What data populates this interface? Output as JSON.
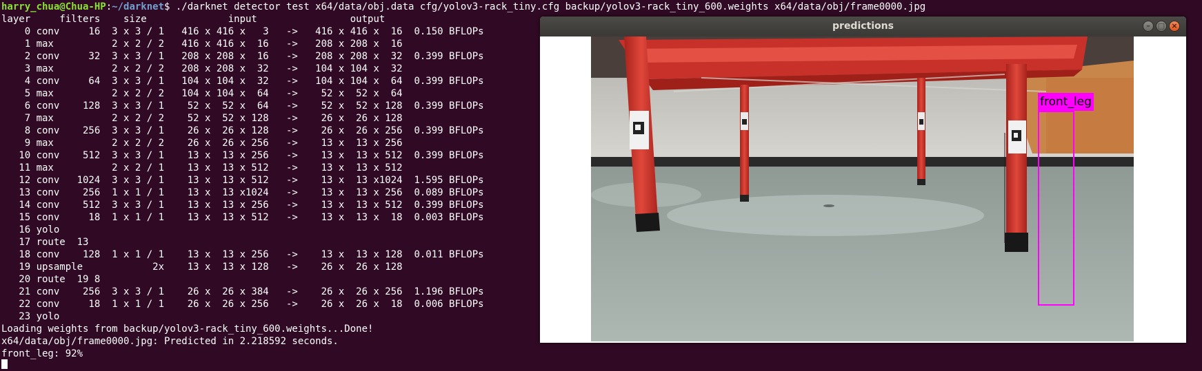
{
  "terminal": {
    "prompt": {
      "user_host": "harry_chua@Chua-HP",
      "separator": ":",
      "path": "~/darknet",
      "symbol": "$",
      "command": " ./darknet detector test x64/data/obj.data cfg/yolov3-rack_tiny.cfg backup/yolov3-rack_tiny_600.weights x64/data/obj/frame0000.jpg"
    },
    "header": "layer     filters    size              input                output",
    "layers": [
      "    0 conv     16  3 x 3 / 1   416 x 416 x   3   ->   416 x 416 x  16  0.150 BFLOPs",
      "    1 max          2 x 2 / 2   416 x 416 x  16   ->   208 x 208 x  16",
      "    2 conv     32  3 x 3 / 1   208 x 208 x  16   ->   208 x 208 x  32  0.399 BFLOPs",
      "    3 max          2 x 2 / 2   208 x 208 x  32   ->   104 x 104 x  32",
      "    4 conv     64  3 x 3 / 1   104 x 104 x  32   ->   104 x 104 x  64  0.399 BFLOPs",
      "    5 max          2 x 2 / 2   104 x 104 x  64   ->    52 x  52 x  64",
      "    6 conv    128  3 x 3 / 1    52 x  52 x  64   ->    52 x  52 x 128  0.399 BFLOPs",
      "    7 max          2 x 2 / 2    52 x  52 x 128   ->    26 x  26 x 128",
      "    8 conv    256  3 x 3 / 1    26 x  26 x 128   ->    26 x  26 x 256  0.399 BFLOPs",
      "    9 max          2 x 2 / 2    26 x  26 x 256   ->    13 x  13 x 256",
      "   10 conv    512  3 x 3 / 1    13 x  13 x 256   ->    13 x  13 x 512  0.399 BFLOPs",
      "   11 max          2 x 2 / 1    13 x  13 x 512   ->    13 x  13 x 512",
      "   12 conv   1024  3 x 3 / 1    13 x  13 x 512   ->    13 x  13 x1024  1.595 BFLOPs",
      "   13 conv    256  1 x 1 / 1    13 x  13 x1024   ->    13 x  13 x 256  0.089 BFLOPs",
      "   14 conv    512  3 x 3 / 1    13 x  13 x 256   ->    13 x  13 x 512  0.399 BFLOPs",
      "   15 conv     18  1 x 1 / 1    13 x  13 x 512   ->    13 x  13 x  18  0.003 BFLOPs",
      "   16 yolo",
      "   17 route  13",
      "   18 conv    128  1 x 1 / 1    13 x  13 x 256   ->    13 x  13 x 128  0.011 BFLOPs",
      "   19 upsample            2x    13 x  13 x 128   ->    26 x  26 x 128",
      "   20 route  19 8",
      "   21 conv    256  3 x 3 / 1    26 x  26 x 384   ->    26 x  26 x 256  1.196 BFLOPs",
      "   22 conv     18  1 x 1 / 1    26 x  26 x 256   ->    26 x  26 x  18  0.006 BFLOPs",
      "   23 yolo"
    ],
    "footer": [
      "Loading weights from backup/yolov3-rack_tiny_600.weights...Done!",
      "x64/data/obj/frame0000.jpg: Predicted in 2.218592 seconds.",
      "front_leg: 92%"
    ]
  },
  "window": {
    "title": "predictions",
    "buttons": {
      "minimize": "–",
      "maximize": "□",
      "close": "×"
    },
    "detection": {
      "label": "front_leg",
      "box_color": "#ff00ff"
    }
  },
  "colors": {
    "terminal_bg": "#300a24",
    "prompt_user": "#8ae234",
    "prompt_path": "#729fcf",
    "rack_red": "#d8382e"
  },
  "icons": [
    "minimize-icon",
    "maximize-icon",
    "close-icon"
  ]
}
